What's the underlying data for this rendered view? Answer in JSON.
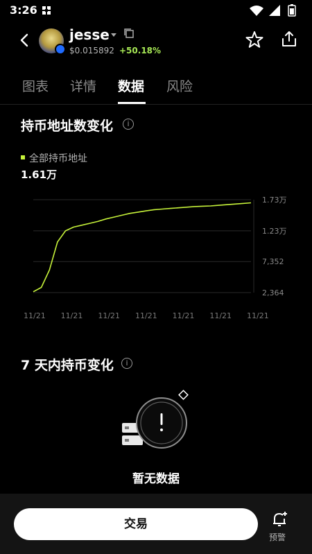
{
  "status_bar": {
    "time": "3:26"
  },
  "header": {
    "token_name": "jesse",
    "price": "$0.015892",
    "change": "+50.18%",
    "change_color": "#a7e855"
  },
  "tabs": [
    {
      "label": "图表",
      "active": false
    },
    {
      "label": "详情",
      "active": false
    },
    {
      "label": "数据",
      "active": true
    },
    {
      "label": "风险",
      "active": false
    }
  ],
  "holders_section": {
    "title": "持币地址数变化",
    "legend_label": "全部持币地址",
    "legend_value": "1.61万",
    "line_color": "#c6f23a"
  },
  "chart_data": {
    "type": "line",
    "x_labels": [
      "11/21",
      "11/21",
      "11/21",
      "11/21",
      "11/21",
      "11/21",
      "11/21"
    ],
    "y_ticks": [
      "1.73万",
      "1.23万",
      "7,352",
      "2,364"
    ],
    "y_tick_values": [
      17300,
      12300,
      7352,
      2364
    ],
    "ylim": [
      2364,
      17300
    ],
    "series": [
      {
        "values": [
          2500,
          3200,
          6000,
          10500,
          12300,
          12900,
          13200,
          13500,
          13800,
          14200,
          14500,
          14800,
          15100,
          15300,
          15500,
          15700,
          15800,
          15900,
          16000,
          16100,
          16200,
          16250,
          16300,
          16400,
          16500,
          16600,
          16700,
          16800
        ]
      }
    ],
    "grid": true
  },
  "weekly_section": {
    "title": "7 天内持币变化",
    "empty_text": "暂无数据"
  },
  "bottom_bar": {
    "trade_label": "交易",
    "alert_label": "预警"
  }
}
